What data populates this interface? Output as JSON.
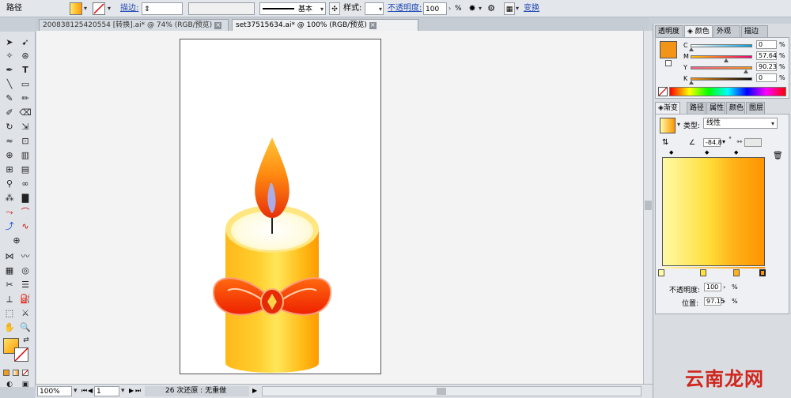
{
  "control_bar": {
    "object_type": "路径",
    "stroke_label": "描边:",
    "stroke_profile": "基本",
    "style_label": "样式:",
    "opacity_label": "不透明度:",
    "opacity_value": "100",
    "opacity_unit": "%",
    "transform_label": "变换"
  },
  "tabs": [
    {
      "label": "200838125420554  [转换].ai* @ 74% (RGB/预览)",
      "active": false
    },
    {
      "label": "set37515634.ai* @ 100% (RGB/预览)",
      "active": true
    }
  ],
  "tab_close_glyph": "×",
  "status_bar": {
    "zoom": "100%",
    "page": "1",
    "undo_text": "26 次还原 : 无重做"
  },
  "color_panel": {
    "tabs": [
      "透明度",
      "颜色",
      "外观",
      "描边"
    ],
    "active_tab": "颜色",
    "channels": [
      {
        "label": "C",
        "value": "0"
      },
      {
        "label": "M",
        "value": "57.64"
      },
      {
        "label": "Y",
        "value": "90.23"
      },
      {
        "label": "K",
        "value": "0"
      }
    ],
    "unit": "%",
    "fill_color": "#f29418"
  },
  "gradient_panel": {
    "tabs": [
      "渐变",
      "路径",
      "属性",
      "颜色",
      "图层"
    ],
    "active_tab": "渐变",
    "type_label": "类型:",
    "type_value": "线性",
    "angle_value": "-84.8",
    "angle_unit": "°",
    "opacity_label": "不透明度:",
    "opacity_value": "100",
    "location_label": "位置:",
    "location_value": "97.15",
    "unit": "%",
    "gradient_start_color": "#fffaa6",
    "gradient_end_color": "#ff9400"
  },
  "watermark": "云南龙网"
}
